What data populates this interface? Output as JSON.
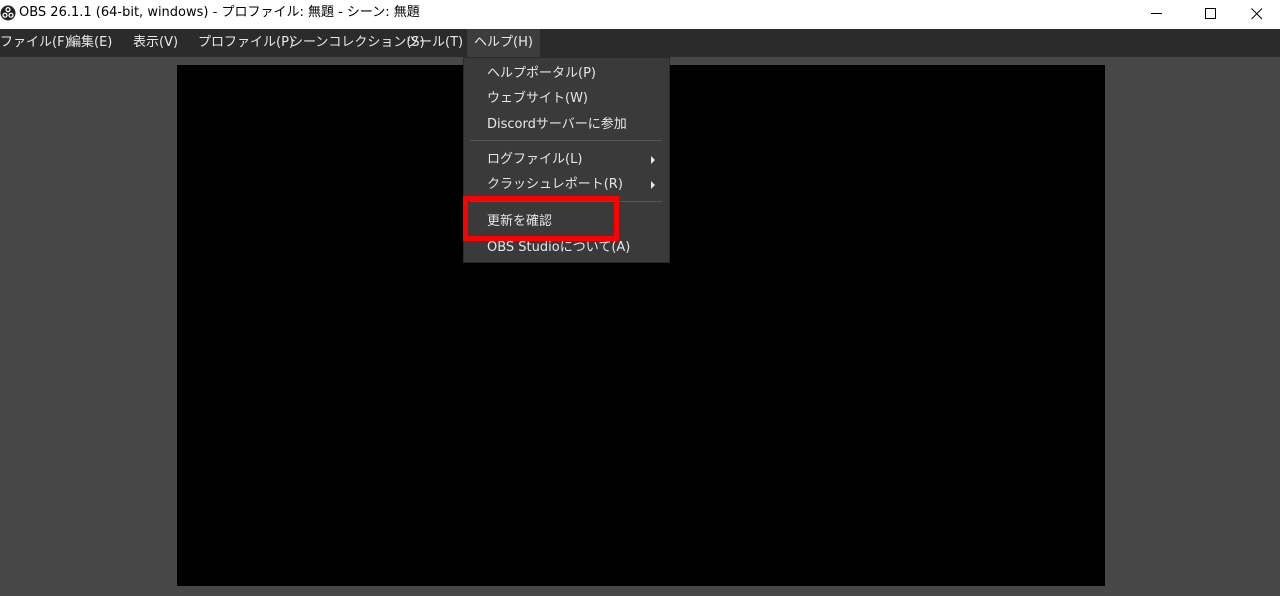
{
  "window": {
    "title": "OBS 26.1.1 (64-bit, windows) - プロファイル: 無題 - シーン: 無題",
    "app_icon": "obs-logo-icon",
    "controls": {
      "minimize_icon": "minimize-icon",
      "maximize_icon": "maximize-icon",
      "close_icon": "close-icon"
    }
  },
  "menubar": {
    "items": [
      {
        "label": "ファイル(F)"
      },
      {
        "label": "編集(E)"
      },
      {
        "label": "表示(V)"
      },
      {
        "label": "プロファイル(P)"
      },
      {
        "label": "シーンコレクション(S)"
      },
      {
        "label": "ツール(T)"
      },
      {
        "label": "ヘルプ(H)",
        "active": true
      }
    ]
  },
  "help_menu": {
    "items": [
      {
        "label": "ヘルプポータル(P)"
      },
      {
        "label": "ウェブサイト(W)"
      },
      {
        "label": "Discordサーバーに参加"
      },
      {
        "label": "ログファイル(L)",
        "submenu": true
      },
      {
        "label": "クラッシュレポート(R)",
        "submenu": true
      },
      {
        "label": "更新を確認",
        "highlighted": true
      },
      {
        "label": "OBS Studioについて(A)"
      }
    ]
  },
  "colors": {
    "titlebar_bg": "#ffffff",
    "menubar_bg": "#2b2b2b",
    "workspace_bg": "#474747",
    "preview_bg": "#000000",
    "dropdown_bg": "#3a3a3a",
    "highlight_border": "#ff0000"
  }
}
